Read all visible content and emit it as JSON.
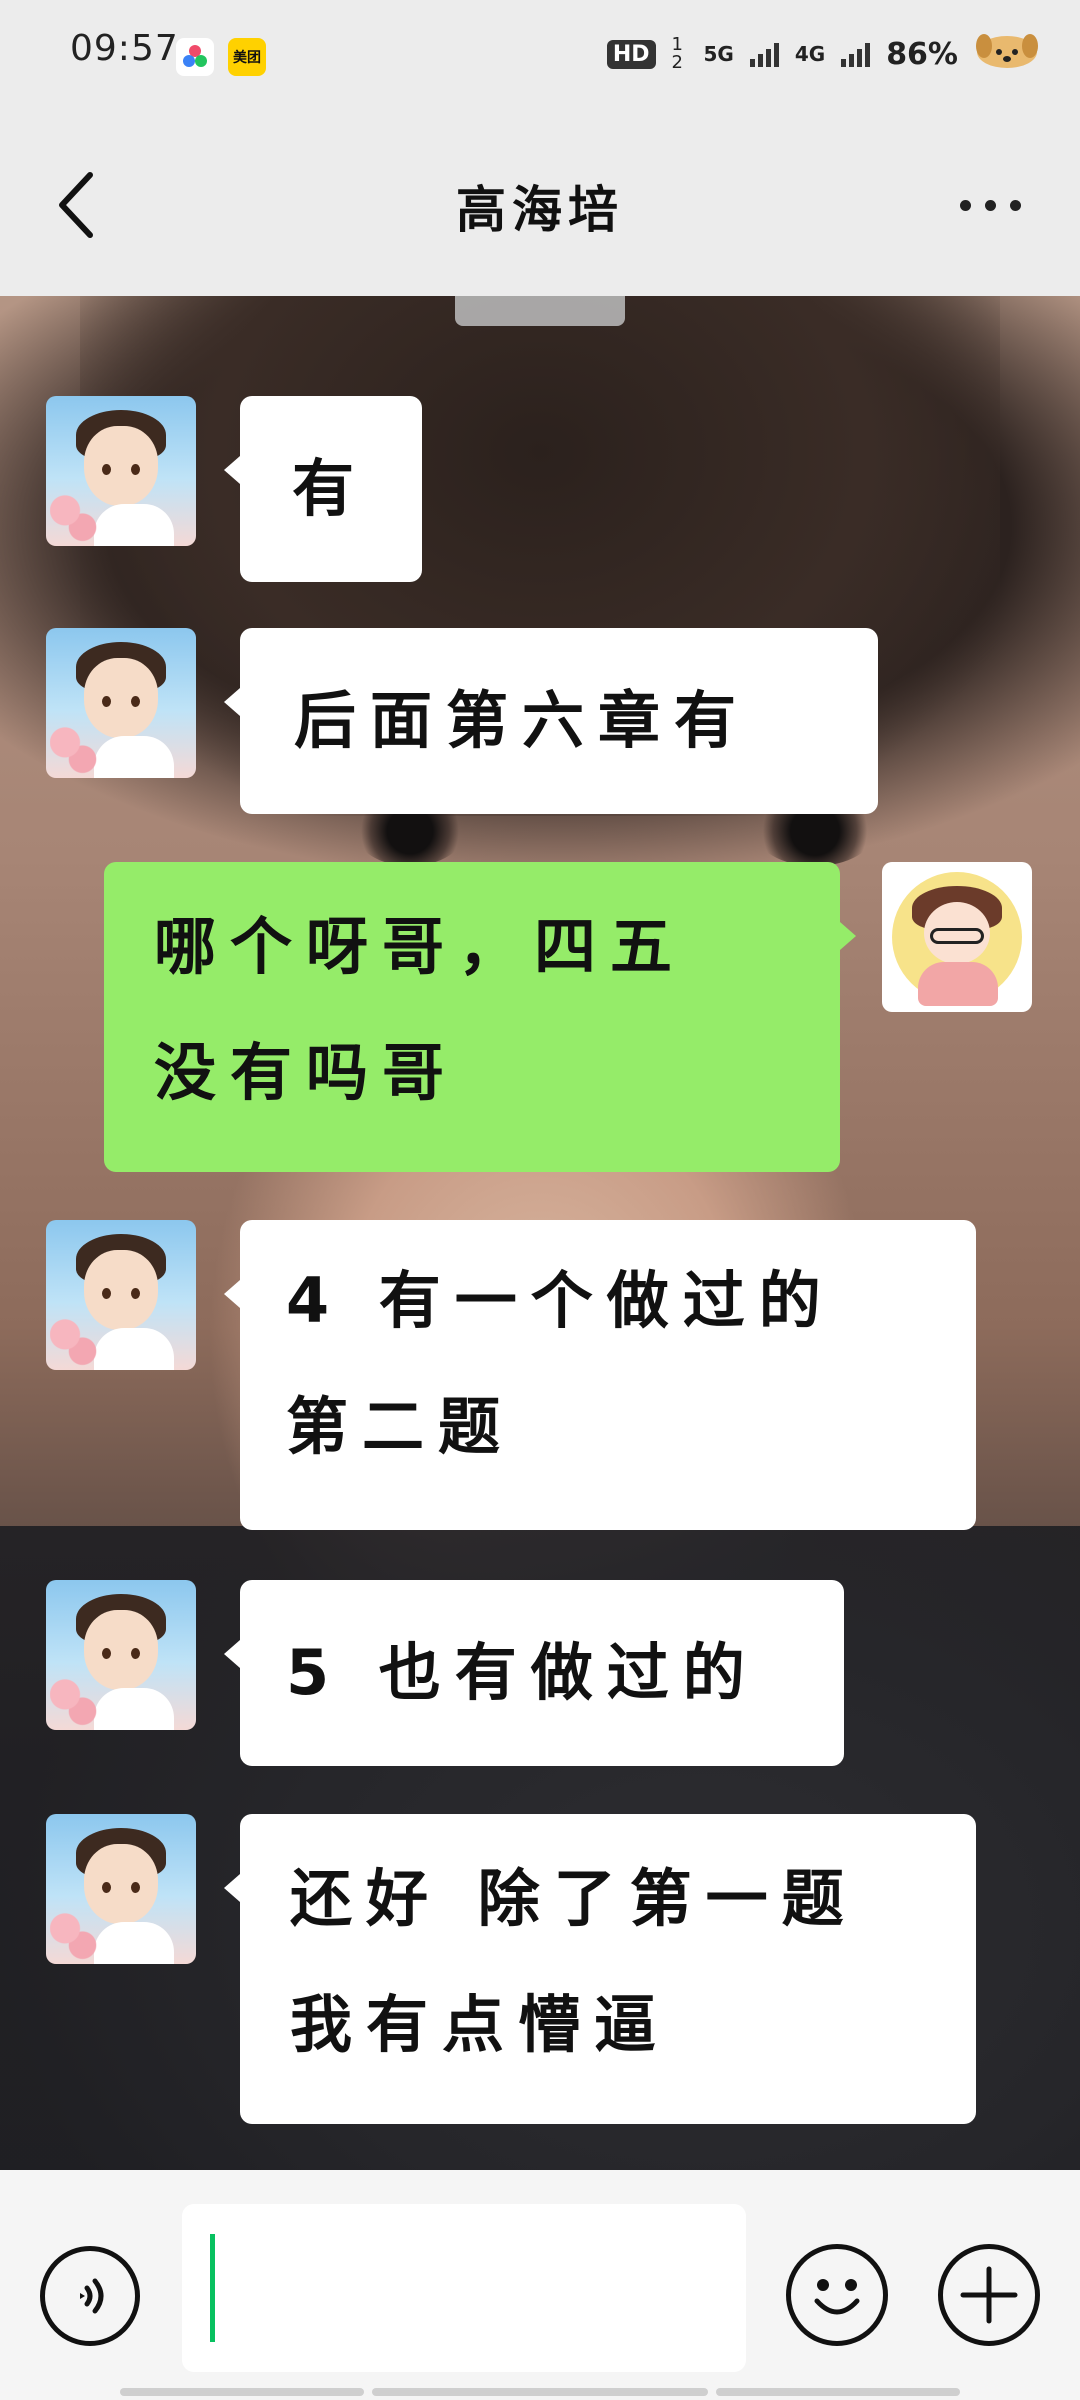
{
  "status_bar": {
    "time": "09:57",
    "app_icons": [
      "flower-app-icon",
      "meituan-icon"
    ],
    "meituan_label": "美团",
    "hd_label": "HD",
    "sim_label": "1 2",
    "net1": "5G",
    "net2": "4G",
    "battery": "86%",
    "icons": [
      "signal-icon",
      "signal-icon",
      "dog-mascot-icon"
    ]
  },
  "header": {
    "title": "高海培",
    "back_icon": "chevron-left-icon",
    "more_icon": "more-dots-icon"
  },
  "messages": [
    {
      "side": "left",
      "text": "有"
    },
    {
      "side": "left",
      "text": "后面第六章有"
    },
    {
      "side": "right",
      "line1": "哪个呀哥，四五",
      "line2": "没有吗哥"
    },
    {
      "side": "left",
      "line1": "4 有一个做过的",
      "line2": "第二题"
    },
    {
      "side": "left",
      "text": "5 也有做过的"
    },
    {
      "side": "left",
      "line1": "还好 除了第一题",
      "line2": "我有点懵逼"
    }
  ],
  "input_bar": {
    "value": "",
    "voice_icon": "voice-icon",
    "emoji_icon": "emoji-icon",
    "plus_icon": "plus-icon"
  },
  "colors": {
    "outgoing_bubble": "#95ec69",
    "incoming_bubble": "#ffffff",
    "caret": "#07c160"
  }
}
